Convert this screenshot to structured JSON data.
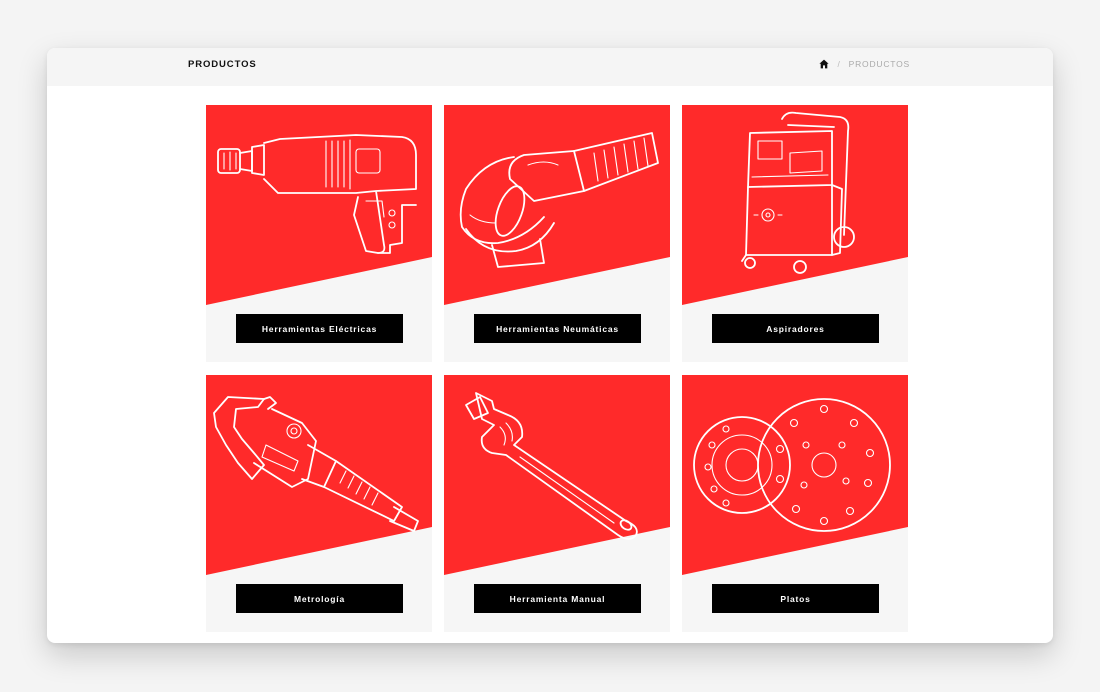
{
  "header": {
    "title": "PRODUCTOS",
    "breadcrumb": {
      "home_icon": "home-icon",
      "separator": "/",
      "current": "PRODUCTOS"
    }
  },
  "colors": {
    "accent": "#ff2a2a",
    "button_bg": "#000000",
    "card_bg": "#f6f6f6"
  },
  "products": [
    {
      "label": "Herramientas Eléctricas",
      "icon": "drill-icon"
    },
    {
      "label": "Herramientas Neumáticas",
      "icon": "angle-grinder-icon"
    },
    {
      "label": "Aspiradores",
      "icon": "vacuum-cleaner-icon"
    },
    {
      "label": "Metrología",
      "icon": "micrometer-icon"
    },
    {
      "label": "Herramienta Manual",
      "icon": "wrench-icon"
    },
    {
      "label": "Platos",
      "icon": "sanding-disc-icon"
    }
  ]
}
